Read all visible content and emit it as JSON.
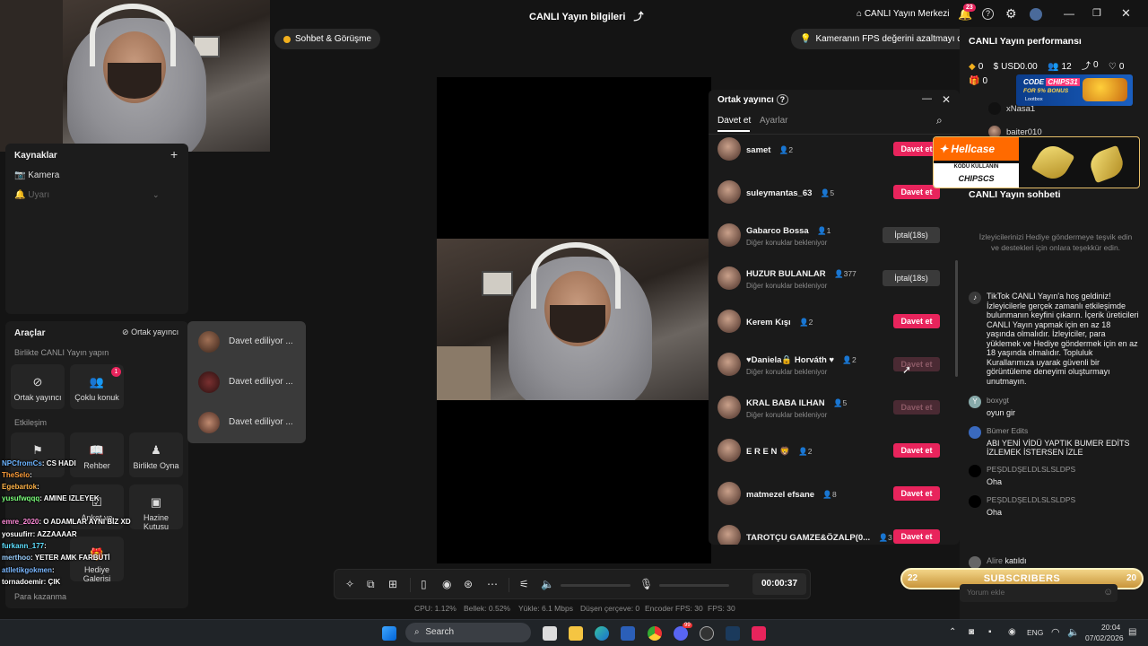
{
  "header": {
    "title": "CANLI Yayın bilgileri",
    "center_link": "CANLI Yayın Merkezi",
    "notif_count": "23"
  },
  "pills": {
    "left": "Sohbet & Görüşme",
    "right": "Kameranın FPS değerini azaltmayı deneyin"
  },
  "sources": {
    "title": "Kaynaklar",
    "items": [
      "Kamera",
      "Uyarı"
    ]
  },
  "tools": {
    "title": "Araçlar",
    "cohost_link": "Ortak yayıncı",
    "together_title": "Birlikte CANLI Yayın yapın",
    "tile_cohost": "Ortak yayıncı",
    "tile_multi": "Çoklu konuk",
    "multi_badge": "1",
    "engagement_title": "Etkileşim",
    "tile_guide": "Rehber",
    "tile_play": "Birlikte Oyna",
    "tile_poll": "Anket ve",
    "tile_poll2": "",
    "tile_treasure": "Hazine",
    "tile_treasure2": "Kutusu",
    "tile_gallery": "Hediye",
    "tile_gallery2": "Galerisi",
    "earn_title": "Para kazanma"
  },
  "invites": {
    "items": [
      "Davet ediliyor ...",
      "Davet ediliyor ...",
      "Davet ediliyor ..."
    ]
  },
  "cohost_panel": {
    "title": "Ortak yayıncı",
    "tab_invite": "Davet et",
    "tab_settings": "Ayarlar",
    "waiting_text": "Diğer konuklar bekleniyor",
    "guests": [
      {
        "name": "samet",
        "count": "2",
        "sub": "",
        "action": "Davet et",
        "state": "red"
      },
      {
        "name": "suleymantas_63",
        "count": "5",
        "sub": "",
        "action": "Davet et",
        "state": "red"
      },
      {
        "name": "Gabarco Bossa",
        "count": "1",
        "sub": "Diğer konuklar bekleniyor",
        "action": "İptal(18s)",
        "state": "grey"
      },
      {
        "name": "HUZUR BULANLAR",
        "count": "377",
        "sub": "Diğer konuklar bekleniyor",
        "action": "İptal(18s)",
        "state": "grey"
      },
      {
        "name": "Kerem Kışı",
        "count": "2",
        "sub": "",
        "action": "Davet et",
        "state": "red"
      },
      {
        "name": "♥Daniela🔒 Horváth ♥",
        "count": "2",
        "sub": "Diğer konuklar bekleniyor",
        "action": "Davet et",
        "state": "dim"
      },
      {
        "name": "KRAL BABA ILHAN",
        "count": "5",
        "sub": "Diğer konuklar bekleniyor",
        "action": "Davet et",
        "state": "dim"
      },
      {
        "name": "E R E N 🦁",
        "count": "2",
        "sub": "",
        "action": "Davet et",
        "state": "red"
      },
      {
        "name": "matmezel efsane",
        "count": "8",
        "sub": "",
        "action": "Davet et",
        "state": "red"
      },
      {
        "name": "TAROTÇU GAMZE&ÖZALP(0...",
        "count": "3",
        "sub": "",
        "action": "Davet et",
        "state": "red"
      }
    ]
  },
  "performance": {
    "title": "CANLI Yayın performansı",
    "diamonds": "0",
    "usd": "USD0.00",
    "viewers": "12",
    "shares": "0",
    "likes": "0",
    "gifts": "0",
    "users": [
      "xNasa1",
      "baiter010"
    ]
  },
  "ads": {
    "code_line1": "CODE",
    "code_value": "CHIPS31",
    "code_line2": "FOR 5% BONUS",
    "code_brand": "Lootbox",
    "hellcase": "Hellcase",
    "hellcase_sub": "KODU KULLANIN",
    "hellcase_code": "CHIPSCS"
  },
  "chat": {
    "title": "CANLI Yayın sohbeti",
    "gift_tip": "İzleyicilerinizi Hediye göndermeye teşvik edin ve destekleri için onlara teşekkür edin.",
    "welcome": "TikTok CANLI Yayın'a hoş geldiniz! İzleyicilerle gerçek zamanlı etkileşimde bulunmanın keyfini çıkarın. İçerik üreticileri CANLI Yayın yapmak için en az 18 yaşında olmalıdır. İzleyiciler, para yüklemek ve Hediye göndermek için en az 18 yaşında olmalıdır. Topluluk Kurallarımıza uyarak güvenli bir görüntüleme deneyimi oluşturmayı unutmayın.",
    "messages": [
      {
        "user": "boxygt",
        "text": "oyun gir"
      },
      {
        "user": "Bümer Edits",
        "text": "ABI YENİ VİDÜ YAPTIK BUMER EDİTS İZLEMEK İSTERSEN İZLE"
      },
      {
        "user": "PEŞDLDŞELDLSLSLDPS",
        "text": "Oha"
      },
      {
        "user": "PEŞDLDŞELDLSLSLDPS",
        "text": "Oha"
      }
    ],
    "join_user": "Alire",
    "join_text": "katıldı",
    "comment_placeholder": "Yorum ekle"
  },
  "subscribers": {
    "label": "SUBSCRIBERS",
    "left": "22",
    "right": "20"
  },
  "overlay_chat": [
    {
      "user": "NPCfromCs",
      "text": ": CS HADI",
      "color": "#6cb4ff"
    },
    {
      "user": "TheSelo",
      "text": ":",
      "color": "#ff9e3a"
    },
    {
      "user": "Egebartok",
      "text": ":",
      "color": "#ffb347"
    },
    {
      "user": "yusufwqqq",
      "text": ": AMINE IZLEYEK",
      "color": "#7bff7b"
    },
    {
      "user": "",
      "text": "",
      "color": "#ff5ab4"
    },
    {
      "user": "emre_2020",
      "text": ": O ADAMLAR AYNI BİZ XD",
      "color": "#ff8ad8"
    },
    {
      "user": "yosuufirr",
      "text": ": AZZAAAAR",
      "color": "#ffffff"
    },
    {
      "user": "furkann_177",
      "text": ":",
      "color": "#5ee0ff"
    },
    {
      "user": "merthoo",
      "text": ": YETER AMK FARBÜTİ",
      "color": "#9ad0ff"
    },
    {
      "user": "atlletikgokmen",
      "text": ":",
      "color": "#7ab7ff"
    },
    {
      "user": "tornadoemir",
      "text": ": ÇIK",
      "color": "#ffffff"
    }
  ],
  "controls": {
    "timer": "00:00:37"
  },
  "status": {
    "cpu": "CPU: 1.12%",
    "mem": "Bellek: 0.52%",
    "upload": "Yükle: 6.1 Mbps",
    "dropped": "Düşen çerçeve: 0",
    "enc_fps": "Encoder FPS: 30",
    "fps": "FPS: 30"
  },
  "taskbar": {
    "search": "Search",
    "lang": "ENG",
    "time": "20:04",
    "date": "07/02/2026",
    "discord_badge": "99"
  },
  "colors": {
    "accent": "#e8245c",
    "hellcase": "#ff6a00",
    "subscribers": "#e8c06a"
  }
}
